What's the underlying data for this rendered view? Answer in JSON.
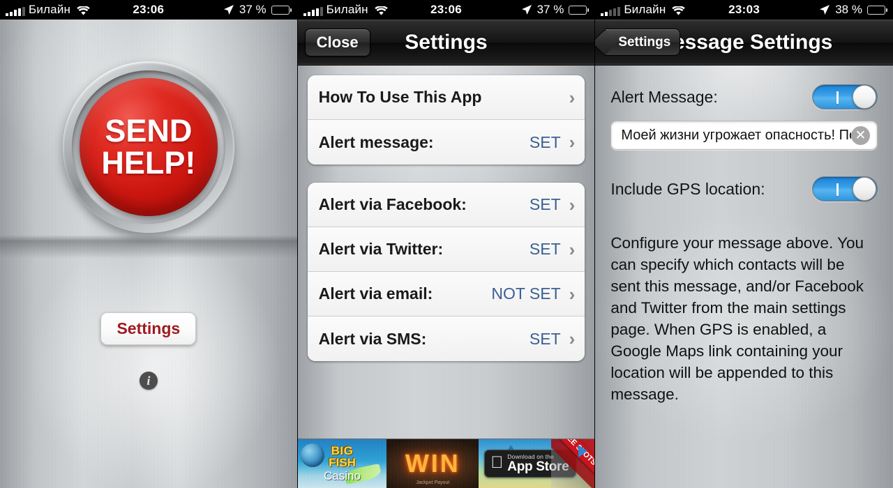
{
  "panels": [
    {
      "statusbar": {
        "carrier": "Билайн",
        "time": "23:06",
        "battery_text": "37 %",
        "battery_percent": 37,
        "signal_bars": 5,
        "wifi_icon": "wifi-icon",
        "location_icon": "location-arrow-icon",
        "battery_icon": "battery-icon"
      },
      "main_button": {
        "line1": "SEND",
        "line2": "HELP!"
      },
      "settings_button": "Settings",
      "info_icon_label": "i"
    },
    {
      "statusbar": {
        "carrier": "Билайн",
        "time": "23:06",
        "battery_text": "37 %",
        "battery_percent": 37,
        "signal_bars": 4,
        "wifi_icon": "wifi-icon",
        "location_icon": "location-arrow-icon",
        "battery_icon": "battery-icon"
      },
      "navbar": {
        "close_label": "Close",
        "title": "Settings"
      },
      "groups": [
        {
          "rows": [
            {
              "label": "How To Use This App",
              "value": ""
            },
            {
              "label": "Alert message:",
              "value": "SET"
            }
          ]
        },
        {
          "rows": [
            {
              "label": "Alert via Facebook:",
              "value": "SET"
            },
            {
              "label": "Alert via Twitter:",
              "value": "SET"
            },
            {
              "label": "Alert via email:",
              "value": "NOT SET"
            },
            {
              "label": "Alert via SMS:",
              "value": "SET"
            }
          ]
        }
      ],
      "ad": {
        "brand_line1": "BIG",
        "brand_line2": "FISH",
        "brand_line3": "Casino",
        "win_text": "WIN",
        "win_sub": "Jackpot Payout",
        "appstore_small": "Download on the",
        "appstore_big": "App Store",
        "ribbon_line1": "FREE",
        "ribbon_line2": "SLOTS"
      }
    },
    {
      "statusbar": {
        "carrier": "Билайн",
        "time": "23:03",
        "battery_text": "38 %",
        "battery_percent": 38,
        "signal_bars": 2,
        "wifi_icon": "wifi-icon",
        "location_icon": "location-arrow-icon",
        "battery_icon": "battery-icon"
      },
      "navbar": {
        "back_label": "Settings",
        "title": "Message Settings"
      },
      "alert_message_label": "Alert Message:",
      "alert_message_toggle": "on",
      "alert_message_value": "Моей жизни угрожает опасность! Помо…",
      "clear_icon_label": "✕",
      "gps_label": "Include GPS location:",
      "gps_toggle": "on",
      "description": "Configure your message above.  You can specify which contacts will be sent this message, and/or Facebook and Twitter from the main settings page.  When GPS is enabled, a Google Maps link containing your location will be appended to this message."
    }
  ],
  "colors": {
    "accent_red": "#cc1710",
    "settings_text": "#9e1b20",
    "value_blue": "#3b5f92",
    "toggle_on": "#3ba0e8",
    "navbar_black": "#141414"
  }
}
